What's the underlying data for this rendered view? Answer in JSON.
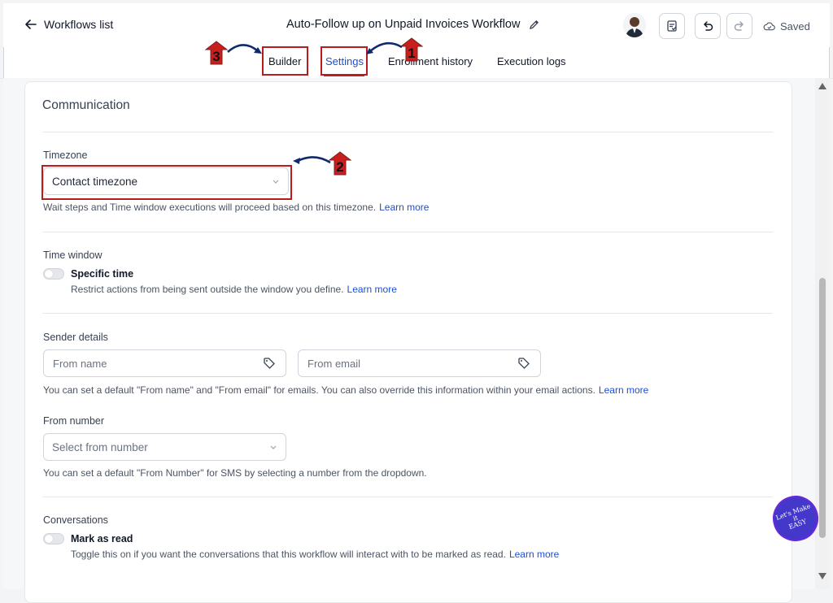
{
  "header": {
    "back_label": "Workflows list",
    "workflow_title": "Auto-Follow up on Unpaid Invoices Workflow",
    "saved_label": "Saved"
  },
  "tabs": [
    {
      "label": "Builder"
    },
    {
      "label": "Settings",
      "active": true
    },
    {
      "label": "Enrollment history"
    },
    {
      "label": "Execution logs"
    }
  ],
  "annotations": {
    "badge_1": "1",
    "badge_2": "2",
    "badge_3": "3"
  },
  "communication": {
    "title": "Communication",
    "timezone": {
      "label": "Timezone",
      "value": "Contact timezone",
      "help": "Wait steps and Time window executions will proceed based on this timezone.",
      "learn_more": "Learn more"
    },
    "time_window": {
      "label": "Time window",
      "toggle_label": "Specific time",
      "help": "Restrict actions from being sent outside the window you define.",
      "learn_more": "Learn more"
    },
    "sender_details": {
      "label": "Sender details",
      "from_name_placeholder": "From name",
      "from_email_placeholder": "From email",
      "help": "You can set a default \"From name\" and \"From email\" for emails. You can also override this information within your email actions.",
      "learn_more": "Learn more"
    },
    "from_number": {
      "label": "From number",
      "placeholder": "Select from number",
      "help": "You can set a default \"From Number\" for SMS by selecting a number from the dropdown."
    },
    "conversations": {
      "label": "Conversations",
      "toggle_label": "Mark as read",
      "help": "Toggle this on if you want the conversations that this workflow will interact with to be marked as read.",
      "learn_more": "Learn more"
    }
  },
  "watermark": {
    "line1": "Let's Make",
    "line2": "it",
    "line3": "EASY"
  },
  "colors": {
    "accent": "#1d4ed8",
    "annotation_red": "#b91c1c",
    "annotation_arrow": "#0f2a6b"
  }
}
